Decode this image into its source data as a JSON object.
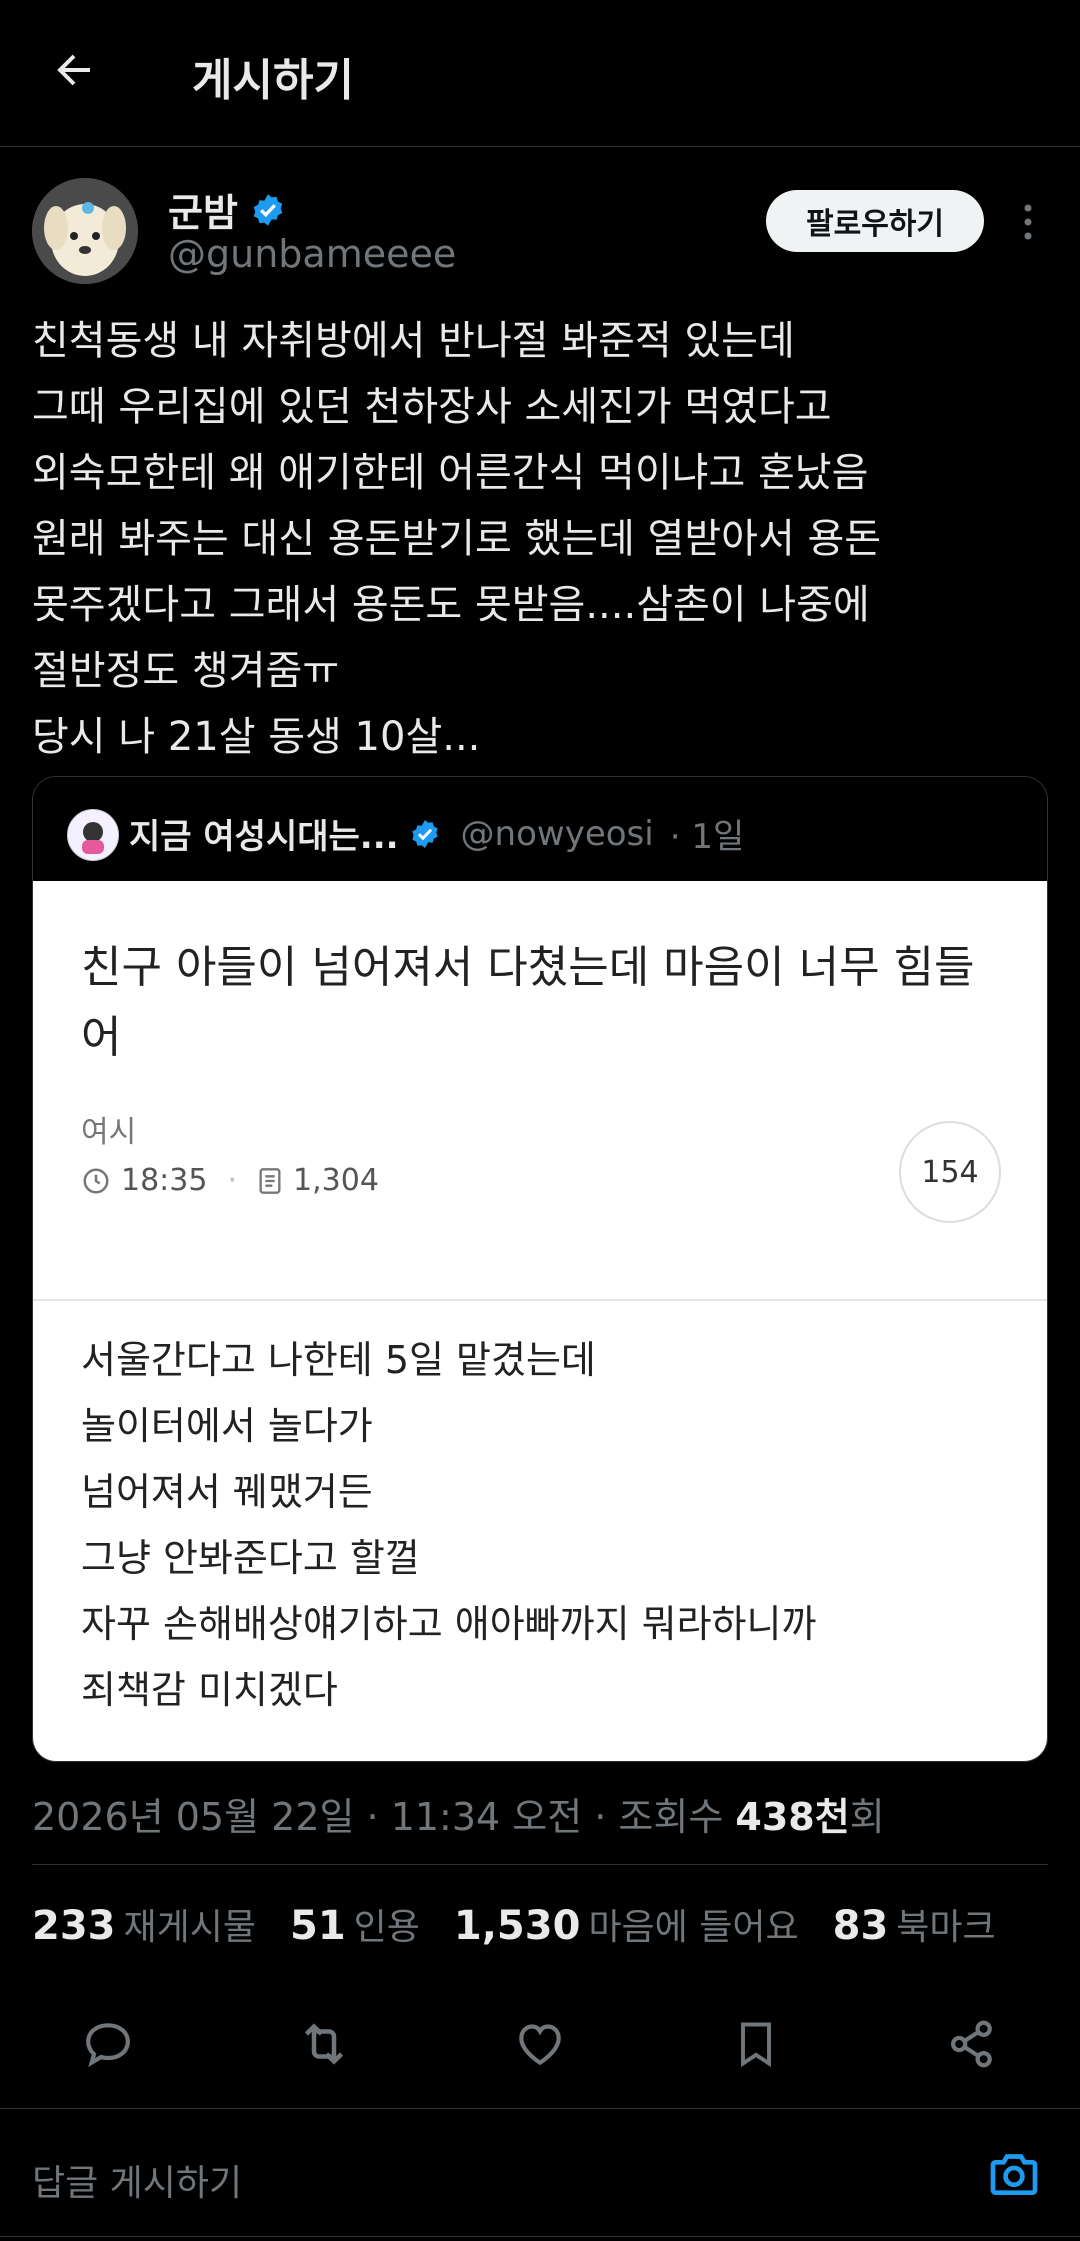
{
  "header": {
    "title": "게시하기"
  },
  "author": {
    "name": "군밤",
    "handle": "@gunbameeee",
    "follow_label": "팔로우하기"
  },
  "tweet_lines": [
    "친척동생 내 자취방에서 반나절 봐준적 있는데",
    "그때 우리집에 있던 천하장사 소세진가 먹였다고",
    "외숙모한테 왜 애기한테 어른간식 먹이냐고 혼났음",
    "원래 봐주는 대신 용돈받기로 했는데 열받아서 용돈",
    "못주겠다고 그래서 용돈도 못받음....삼촌이 나중에",
    "절반정도 챙겨줌ㅠ",
    "당시 나 21살 동생 10살..."
  ],
  "quote": {
    "name": "지금 여성시대는...",
    "handle": "@nowyeosi",
    "time": "· 1일",
    "title": "친구 아들이 넘어져서 다쳤는데 마음이 너무 힘들어",
    "source": "여시",
    "post_time": "18:35",
    "views": "1,304",
    "comment_count": "154",
    "body_lines": [
      "서울간다고 나한테 5일 맡겼는데",
      "놀이터에서 놀다가",
      "넘어져서 꿰맸거든",
      "그냥 안봐준다고 할껄",
      "자꾸 손해배상얘기하고 애아빠까지 뭐라하니까",
      "죄책감 미치겠다"
    ]
  },
  "meta": {
    "date": "2026년 05월 22일 · 11:34 오전 · 조회수 ",
    "views": "438천",
    "views_suffix": "회"
  },
  "stats": [
    {
      "count": "233",
      "label": "재게시물"
    },
    {
      "count": "51",
      "label": "인용"
    },
    {
      "count": "1,530",
      "label": "마음에 들어요"
    },
    {
      "count": "83",
      "label": "북마크"
    }
  ],
  "reply_placeholder": "답글 게시하기",
  "colors": {
    "verified": "#1d9bf0",
    "accent": "#1d9bf0"
  }
}
